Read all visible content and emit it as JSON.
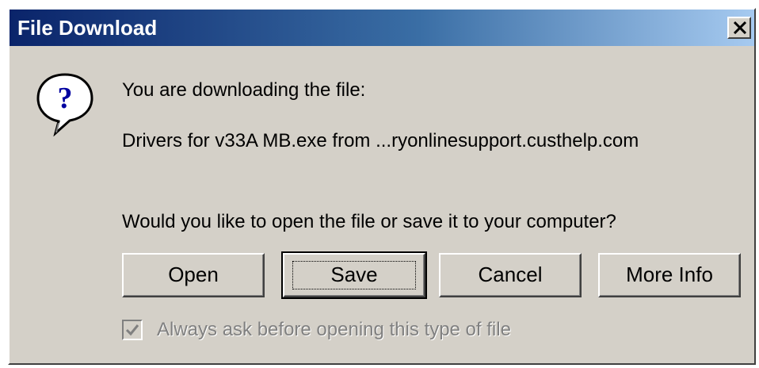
{
  "window": {
    "title": "File Download",
    "close_glyph": "×"
  },
  "message": {
    "line1": "You are downloading the file:",
    "file_line": "Drivers for v33A MB.exe from ...ryonlinesupport.custhelp.com",
    "question": "Would you like to open the file or save it to your computer?"
  },
  "icon": {
    "name": "question-icon",
    "glyph": "?"
  },
  "buttons": {
    "open": "Open",
    "save": "Save",
    "cancel": "Cancel",
    "more_info": "More Info",
    "default_button": "save"
  },
  "checkbox": {
    "label": "Always ask before opening this type of file",
    "checked": true,
    "enabled": false
  },
  "colors": {
    "dialog_bg": "#d4d0c8",
    "title_start": "#0a246a",
    "title_end": "#a6caf0",
    "disabled_text": "#808080"
  }
}
